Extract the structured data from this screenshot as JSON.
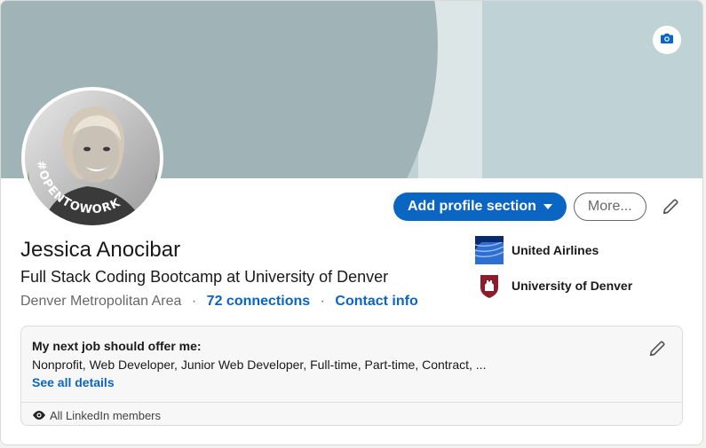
{
  "profile": {
    "name": "Jessica Anocibar",
    "headline": "Full Stack Coding Bootcamp at University of Denver",
    "location": "Denver Metropolitan Area",
    "separator": "·",
    "connections_label": "72 connections",
    "contact_label": "Contact info",
    "open_to_work_ring_text": "#OPENTOWORK"
  },
  "actions": {
    "add_section_label": "Add profile section",
    "more_label": "More..."
  },
  "organizations": [
    {
      "name": "United Airlines",
      "icon": "united-airlines-logo"
    },
    {
      "name": "University of Denver",
      "icon": "university-of-denver-logo"
    }
  ],
  "open_to_work": {
    "title": "My next job should offer me:",
    "description": "Nonprofit, Web Developer, Junior Web Developer, Full-time, Part-time, Contract, ...",
    "details_link": "See all details",
    "visibility": "All LinkedIn members"
  },
  "icons": {
    "camera": "camera-icon",
    "edit": "pencil-icon",
    "visibility": "eye-icon",
    "dropdown": "caret-down-icon"
  },
  "colors": {
    "brand_blue": "#0a66c2",
    "banner_light": "#bfd2d5",
    "banner_dark": "#a0b3b6",
    "otw_green": "#3b8a2e"
  }
}
